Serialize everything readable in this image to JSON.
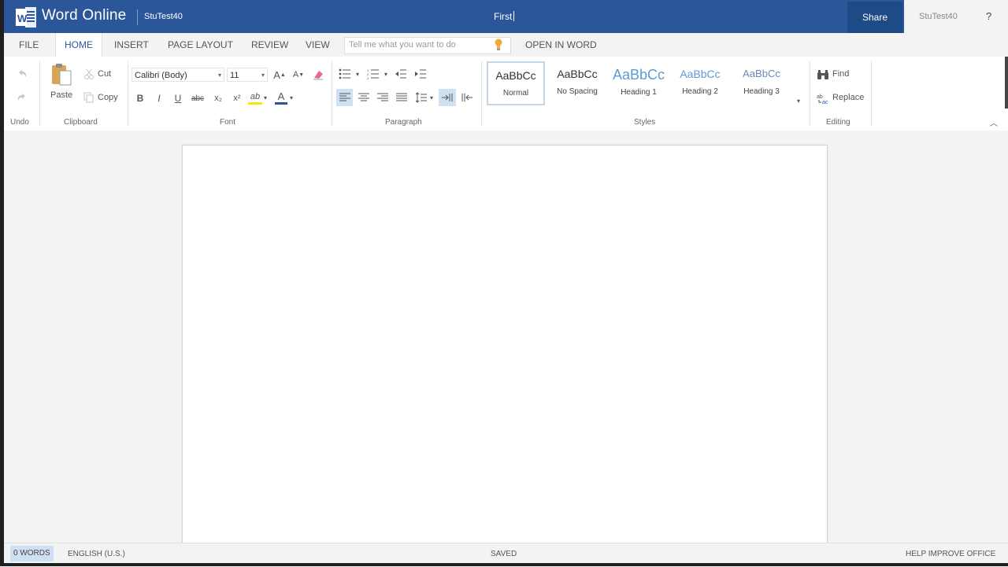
{
  "titlebar": {
    "app_name": "Word Online",
    "owner": "StuTest40",
    "document_title": "First",
    "share_label": "Share",
    "user_name": "StuTest40",
    "help_label": "?"
  },
  "tabs": [
    {
      "label": "FILE"
    },
    {
      "label": "HOME"
    },
    {
      "label": "INSERT"
    },
    {
      "label": "PAGE LAYOUT"
    },
    {
      "label": "REVIEW"
    },
    {
      "label": "VIEW"
    }
  ],
  "tell_me": {
    "placeholder": "Tell me what you want to do"
  },
  "open_in_word": "OPEN IN WORD",
  "ribbon": {
    "clipboard": {
      "paste": "Paste",
      "cut": "Cut",
      "copy": "Copy",
      "group": "Clipboard"
    },
    "undo_group": "Undo",
    "font": {
      "family": "Calibri (Body)",
      "size": "11",
      "group": "Font",
      "bold": "B",
      "italic": "I",
      "underline": "U",
      "strike": "abc",
      "subscript": "x₂",
      "superscript": "x²",
      "highlight": "ab",
      "color": "A",
      "grow": "A",
      "shrink": "A"
    },
    "paragraph": {
      "group": "Paragraph"
    },
    "styles": {
      "group": "Styles",
      "items": [
        {
          "sample": "AaBbCc",
          "name": "Normal"
        },
        {
          "sample": "AaBbCc",
          "name": "No Spacing"
        },
        {
          "sample": "AaBbCc",
          "name": "Heading 1"
        },
        {
          "sample": "AaBbCc",
          "name": "Heading 2"
        },
        {
          "sample": "AaBbCc",
          "name": "Heading 3"
        }
      ]
    },
    "editing": {
      "group": "Editing",
      "find": "Find",
      "replace": "Replace"
    }
  },
  "status": {
    "words": "0 WORDS",
    "language": "ENGLISH (U.S.)",
    "saved": "SAVED",
    "help_improve": "HELP IMPROVE OFFICE"
  },
  "colors": {
    "brand": "#2b579a",
    "share_bg": "#1e4a85",
    "heading_blue": "#5b9bd5"
  }
}
